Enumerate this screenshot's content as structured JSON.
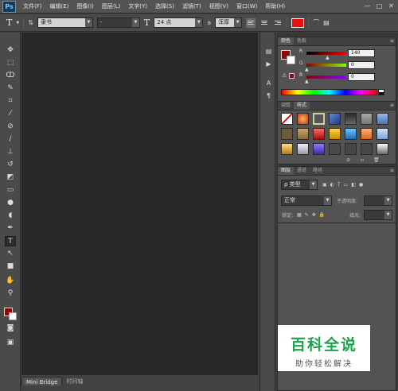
{
  "app": {
    "logo": "Ps"
  },
  "menu": [
    "文件(F)",
    "编辑(E)",
    "图像(I)",
    "图层(L)",
    "文字(Y)",
    "选择(S)",
    "滤镜(T)",
    "视图(V)",
    "窗口(W)",
    "帮助(H)"
  ],
  "window_controls": {
    "minimize": "—",
    "maximize": "□",
    "close": "✕"
  },
  "options": {
    "tool_icon": "T",
    "font_family": "隶书",
    "font_style": "-",
    "size_icon": "T",
    "font_size": "24 点",
    "aa_icon": "a",
    "antialias": "浑厚",
    "text_color": "#e8100d"
  },
  "color_panel": {
    "tabs": [
      "颜色",
      "色板"
    ],
    "fg_color": "#8b0a0a",
    "r_label": "R",
    "r_value": "140",
    "g_label": "G",
    "g_value": "0",
    "b_label": "B",
    "b_value": "0"
  },
  "styles_panel": {
    "tabs": [
      "调整",
      "样式"
    ]
  },
  "layers_panel": {
    "tabs": [
      "图层",
      "通道",
      "路径"
    ],
    "kind_label": "ρ 类型",
    "blend_mode": "正常",
    "opacity_label": "不透明度:",
    "lock_label": "锁定:",
    "fill_label": "填充:"
  },
  "bottom_tabs": [
    "Mini Bridge",
    "时间轴"
  ],
  "watermark": {
    "title": "百科全说",
    "subtitle": "助你轻松解决"
  },
  "colors": {
    "accent_red": "#e8100d",
    "watermark_green": "#1aa34a"
  }
}
